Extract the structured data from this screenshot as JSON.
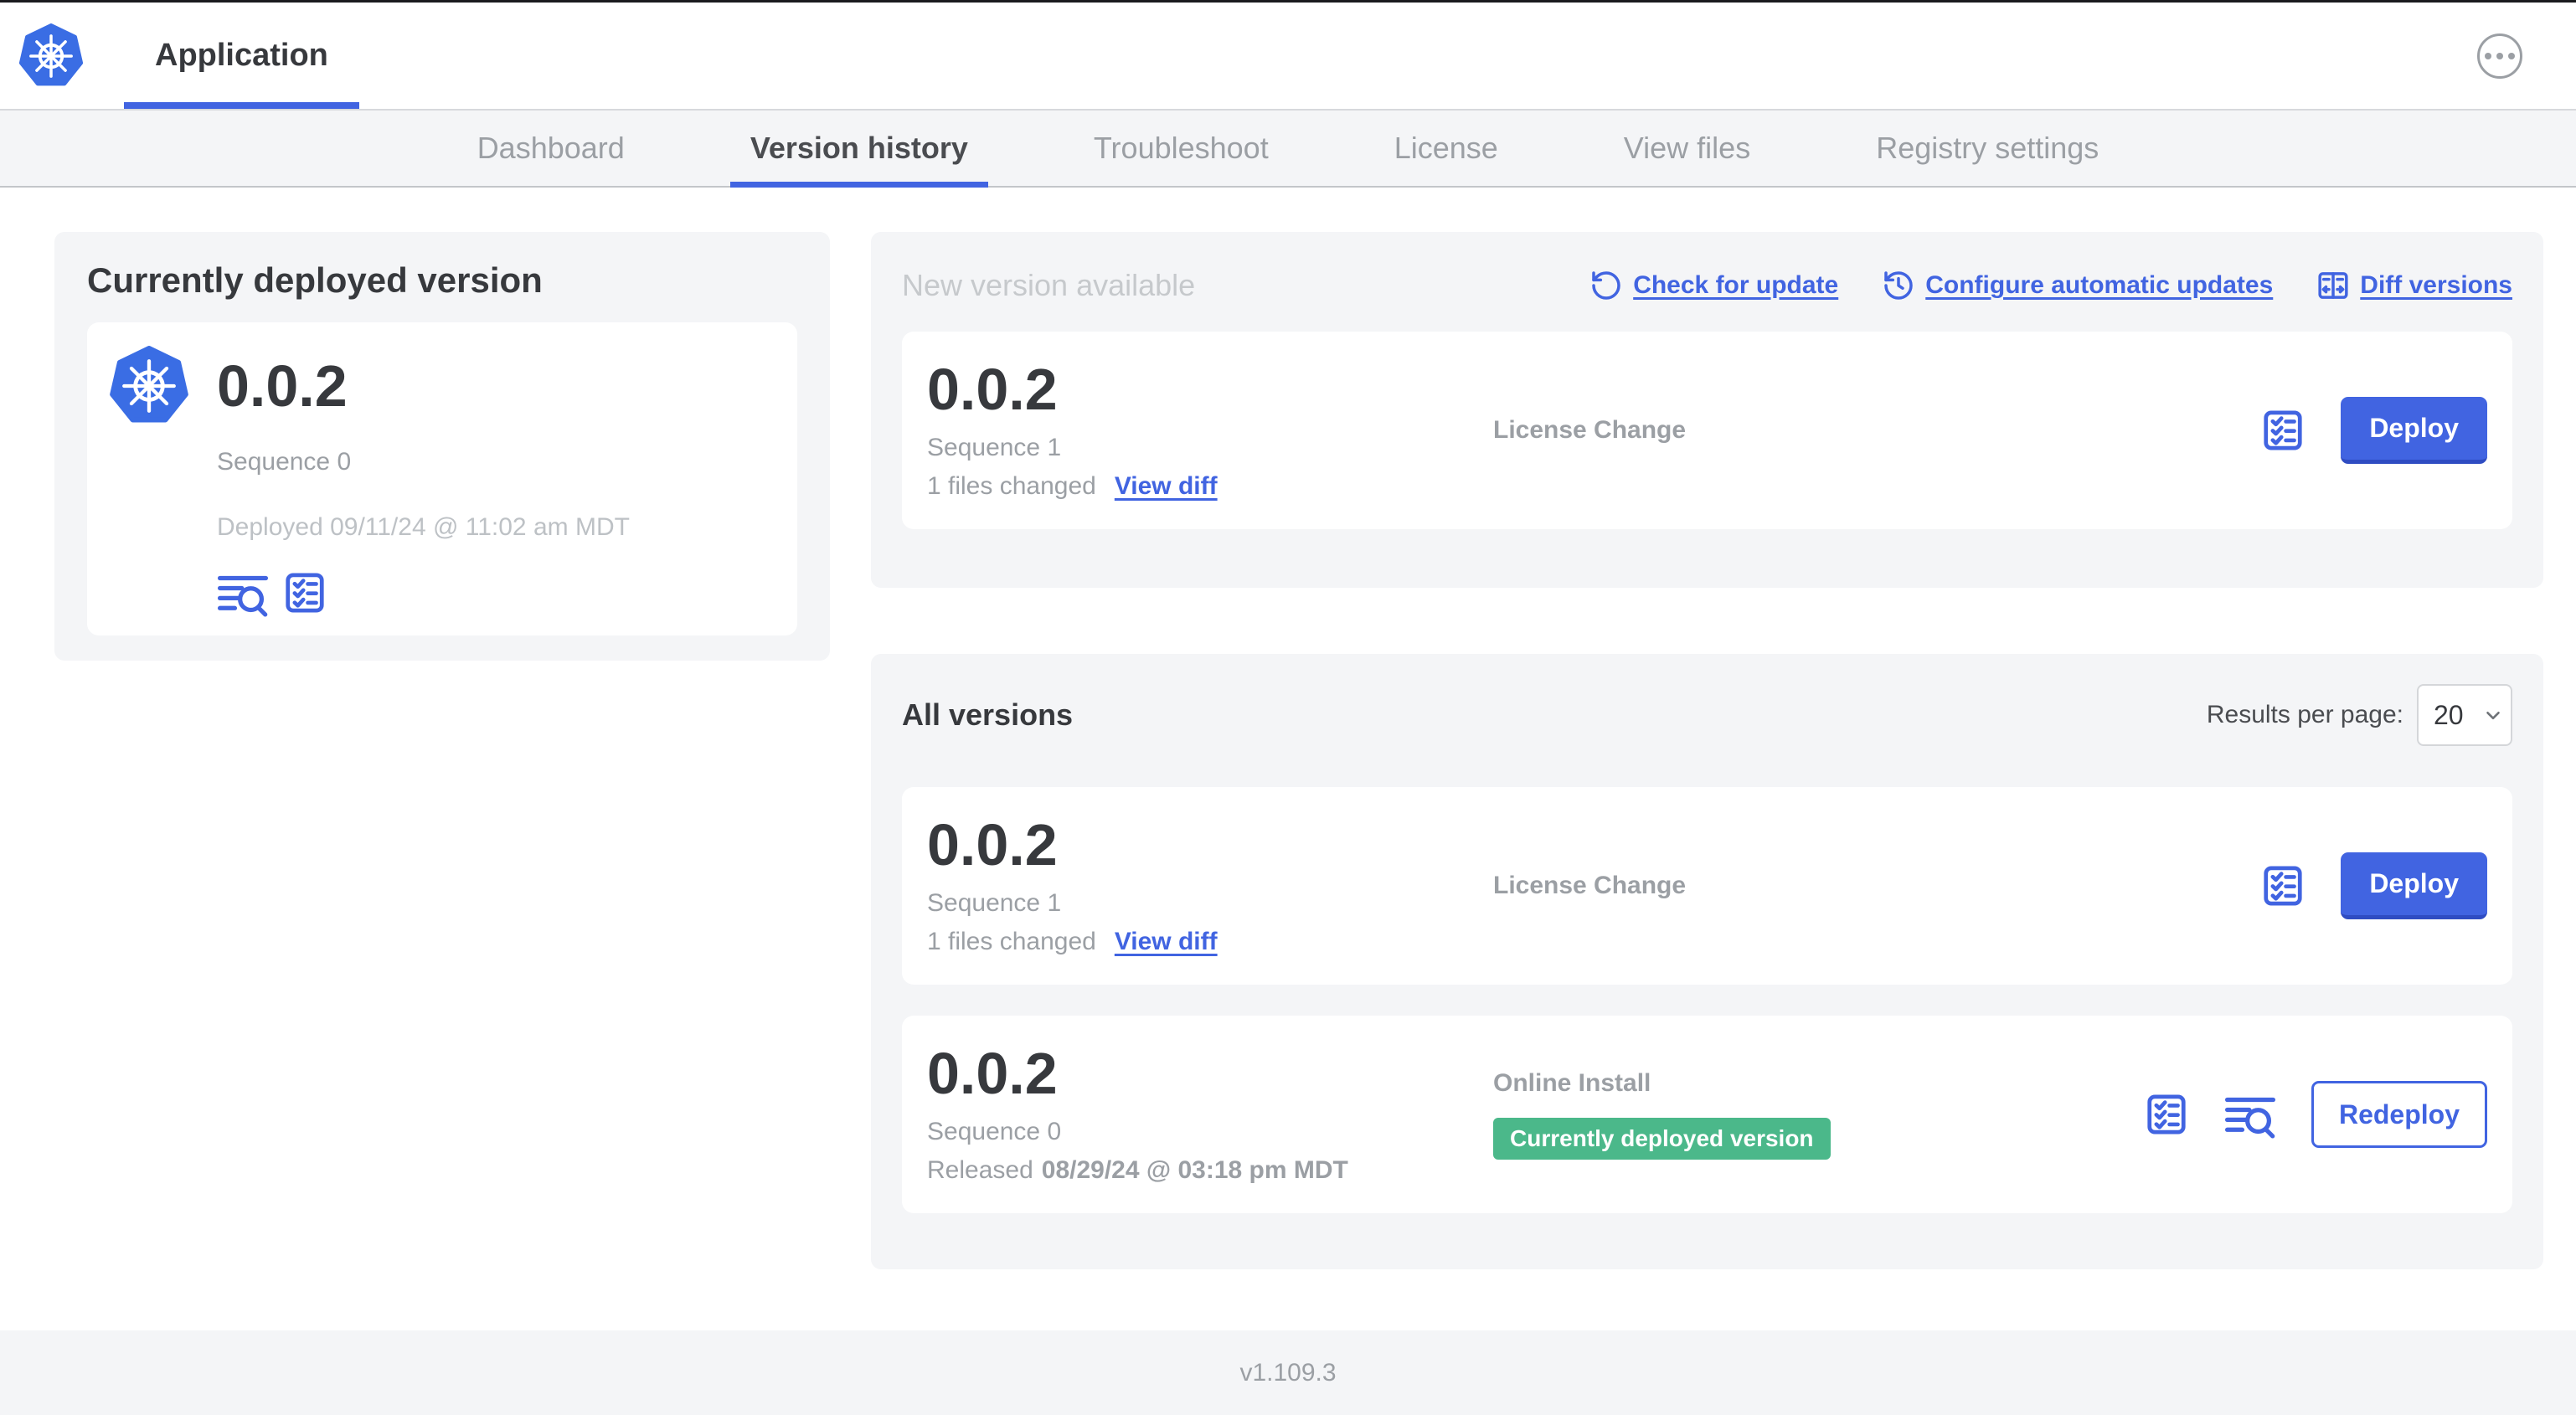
{
  "header": {
    "app_tab_label": "Application"
  },
  "nav": {
    "tabs": [
      {
        "label": "Dashboard",
        "active": false
      },
      {
        "label": "Version history",
        "active": true
      },
      {
        "label": "Troubleshoot",
        "active": false
      },
      {
        "label": "License",
        "active": false
      },
      {
        "label": "View files",
        "active": false
      },
      {
        "label": "Registry settings",
        "active": false
      }
    ]
  },
  "current_version": {
    "title": "Currently deployed version",
    "version": "0.0.2",
    "sequence": "Sequence 0",
    "deployed": "Deployed 09/11/24 @ 11:02 am MDT",
    "icons": [
      "view-logs-icon",
      "preflight-checks-icon"
    ]
  },
  "new_version": {
    "title": "New version available",
    "actions": [
      {
        "label": "Check for update",
        "icon": "refresh-icon"
      },
      {
        "label": "Configure automatic updates",
        "icon": "schedule-icon"
      },
      {
        "label": "Diff versions",
        "icon": "diff-icon"
      }
    ],
    "row": {
      "version": "0.0.2",
      "sequence": "Sequence 1",
      "files_changed": "1 files changed",
      "view_diff_label": "View diff",
      "source": "License Change",
      "action_label": "Deploy"
    }
  },
  "all_versions": {
    "title": "All versions",
    "results_per_page_label": "Results per page:",
    "results_per_page_value": "20",
    "rows": [
      {
        "version": "0.0.2",
        "sequence": "Sequence 1",
        "files_changed": "1 files changed",
        "view_diff_label": "View diff",
        "source": "License Change",
        "action_label": "Deploy"
      },
      {
        "version": "0.0.2",
        "sequence": "Sequence 0",
        "released_label": "Released",
        "released_date": "08/29/24 @ 03:18 pm MDT",
        "source": "Online Install",
        "badge": "Currently deployed version",
        "action_label": "Redeploy"
      }
    ]
  },
  "footer": {
    "version": "v1.109.3"
  },
  "colors": {
    "accent_blue": "#4164e1",
    "kubernetes_blue": "#3a6de4",
    "badge_green": "#4bb88a",
    "panel_gray": "#f4f5f7"
  }
}
